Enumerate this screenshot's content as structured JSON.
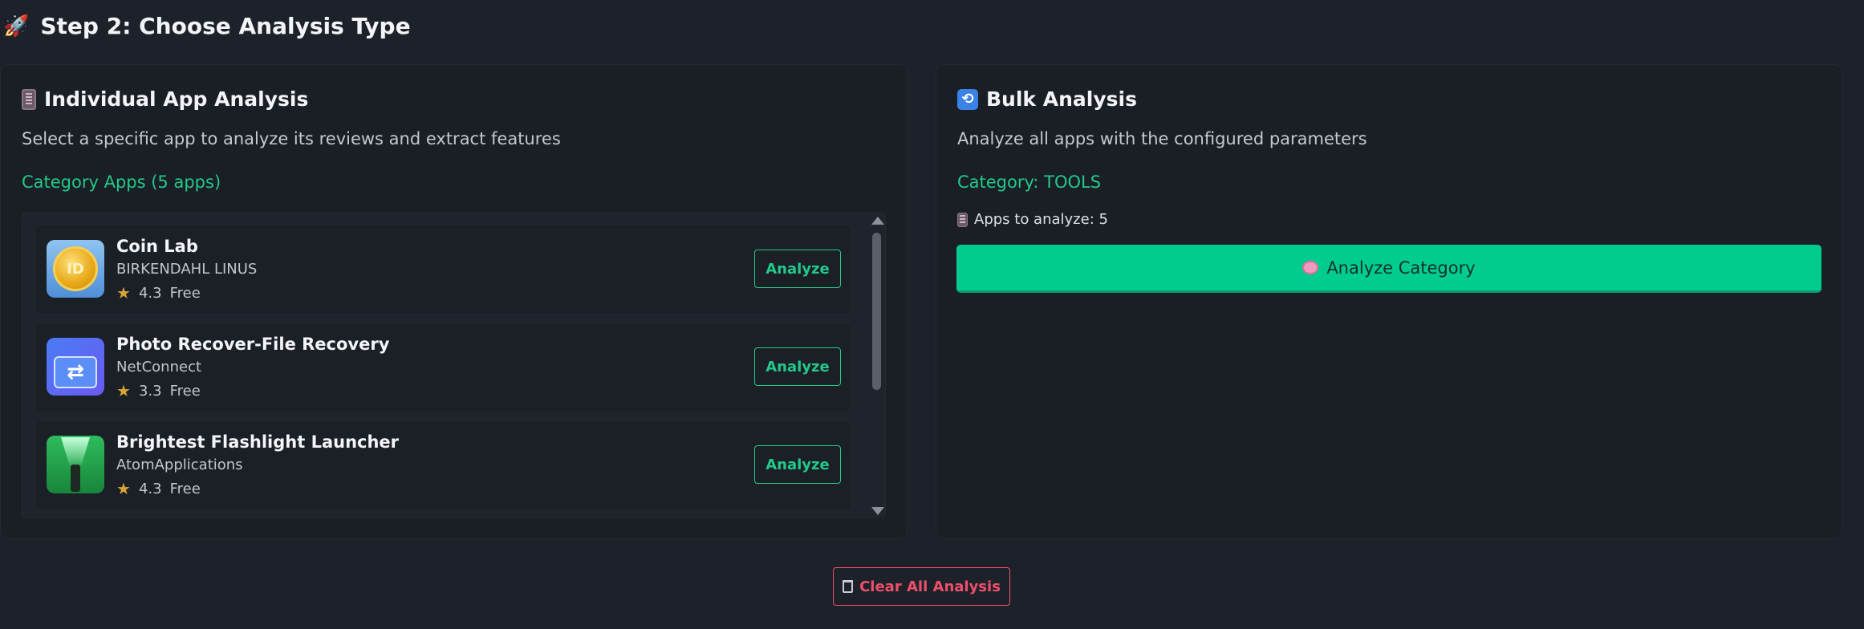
{
  "step": {
    "title": "Step 2: Choose Analysis Type",
    "icon": "🚀"
  },
  "individual": {
    "title": "Individual App Analysis",
    "description": "Select a specific app to analyze its reviews and extract features",
    "list_label": "Category Apps (5 apps)",
    "apps": [
      {
        "name": "Coin Lab",
        "developer": "BIRKENDAHL LINUS",
        "rating": "4.3",
        "price": "Free",
        "button": "Analyze"
      },
      {
        "name": "Photo Recover-File Recovery",
        "developer": "NetConnect",
        "rating": "3.3",
        "price": "Free",
        "button": "Analyze"
      },
      {
        "name": "Brightest Flashlight Launcher",
        "developer": "AtomApplications",
        "rating": "4.3",
        "price": "Free",
        "button": "Analyze"
      }
    ]
  },
  "bulk": {
    "title": "Bulk Analysis",
    "description": "Analyze all apps with the configured parameters",
    "category_label": "Category: TOOLS",
    "apps_count": "Apps to analyze: 5",
    "button": "Analyze Category"
  },
  "clear_button": "Clear All Analysis",
  "colors": {
    "background": "#1d222a",
    "panel": "#1a1e25",
    "accent_green": "#22c98a",
    "primary_button": "#00cc8e",
    "danger": "#f04e6b",
    "star": "#d7a535"
  }
}
